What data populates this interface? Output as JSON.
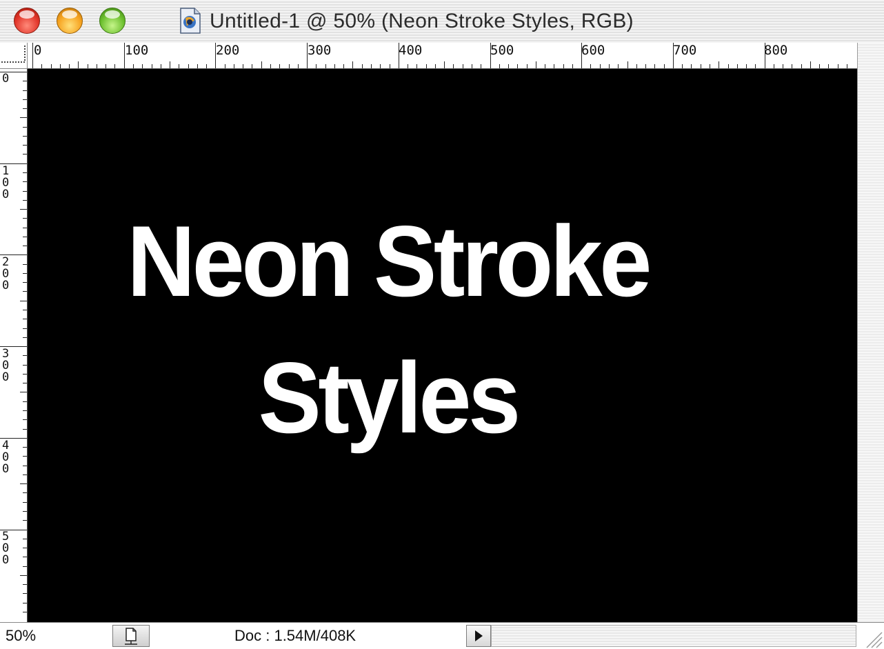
{
  "window": {
    "title": "Untitled-1 @ 50% (Neon Stroke Styles, RGB)",
    "traffic_lights": [
      "close",
      "minimize",
      "zoom"
    ]
  },
  "ruler": {
    "top_labels": [
      "0",
      "100",
      "200",
      "300",
      "400",
      "500",
      "600",
      "700",
      "800"
    ],
    "left_labels": [
      "0",
      "100",
      "200",
      "300",
      "400",
      "500"
    ]
  },
  "canvas": {
    "background": "#000000",
    "text_color": "#ffffff",
    "text_line1": "Neon Stroke",
    "text_line2": "Styles"
  },
  "status": {
    "zoom": "50%",
    "doc_info": "Doc : 1.54M/408K"
  },
  "icons": {
    "document_proxy": "photoshop-document-icon",
    "status_popup": "document-icon",
    "status_arrow": "play-arrow-icon",
    "resize": "resize-grip-icon"
  }
}
